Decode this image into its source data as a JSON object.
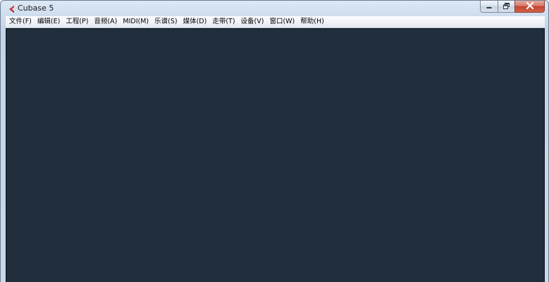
{
  "window": {
    "title": "Cubase 5",
    "app_icon": "cubase-logo-icon",
    "controls": {
      "minimize_icon": "minimize-icon",
      "maximize_icon": "restore-icon",
      "close_icon": "close-icon"
    }
  },
  "menubar": {
    "items": [
      {
        "label": "文件(F)"
      },
      {
        "label": "编辑(E)"
      },
      {
        "label": "工程(P)"
      },
      {
        "label": "音频(A)"
      },
      {
        "label": "MIDI(M)"
      },
      {
        "label": "乐谱(S)"
      },
      {
        "label": "媒体(D)"
      },
      {
        "label": "走带(T)"
      },
      {
        "label": "设备(V)"
      },
      {
        "label": "窗口(W)"
      },
      {
        "label": "帮助(H)"
      }
    ]
  },
  "colors": {
    "workspace_bg": "#212e3b",
    "logo_red": "#c8282b",
    "frame": "#c3d5e9"
  }
}
